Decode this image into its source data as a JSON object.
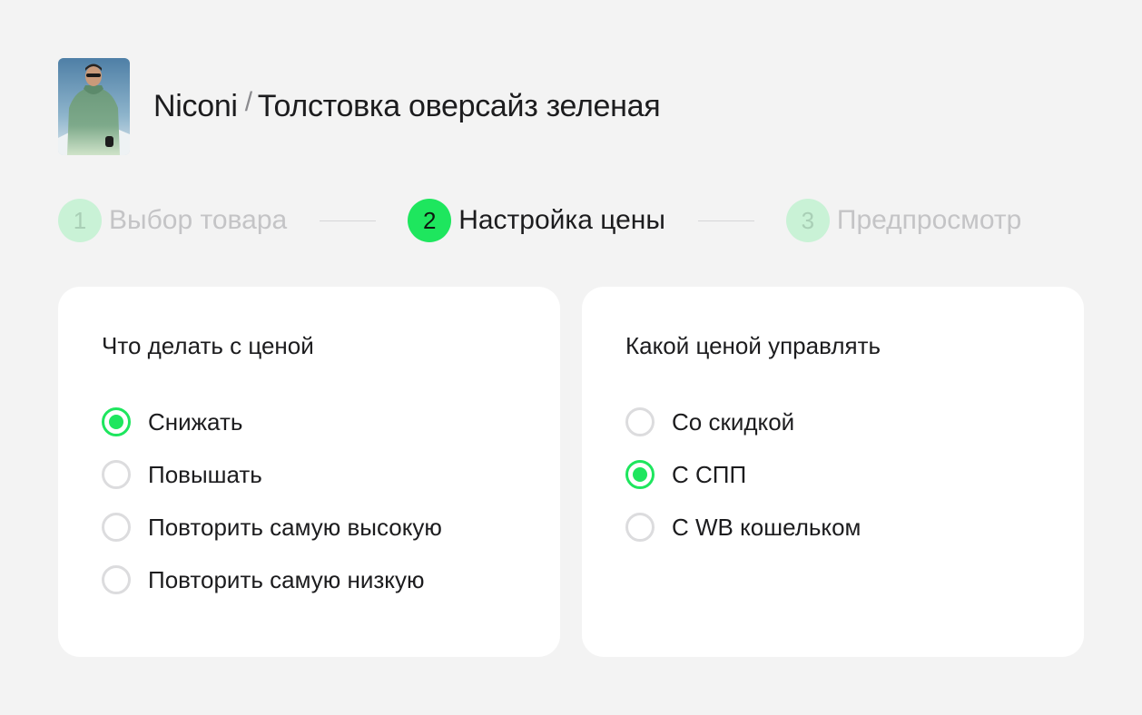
{
  "header": {
    "brand": "Niconi",
    "separator": "/",
    "product": "Толстовка оверсайз зеленая"
  },
  "stepper": {
    "steps": [
      {
        "number": "1",
        "label": "Выбор товара",
        "state": "inactive"
      },
      {
        "number": "2",
        "label": "Настройка цены",
        "state": "active"
      },
      {
        "number": "3",
        "label": "Предпросмотр",
        "state": "inactive"
      }
    ]
  },
  "price_action": {
    "title": "Что делать с ценой",
    "options": [
      {
        "label": "Снижать",
        "selected": true
      },
      {
        "label": "Повышать",
        "selected": false
      },
      {
        "label": "Повторить самую высокую",
        "selected": false
      },
      {
        "label": "Повторить самую низкую",
        "selected": false
      }
    ]
  },
  "price_type": {
    "title": "Какой ценой управлять",
    "options": [
      {
        "label": "Со скидкой",
        "selected": false
      },
      {
        "label": "С СПП",
        "selected": true
      },
      {
        "label": "С WB кошельком",
        "selected": false
      }
    ]
  },
  "colors": {
    "accent": "#1ee65e",
    "accent_light": "#c9f2d6",
    "background": "#f3f3f3"
  }
}
